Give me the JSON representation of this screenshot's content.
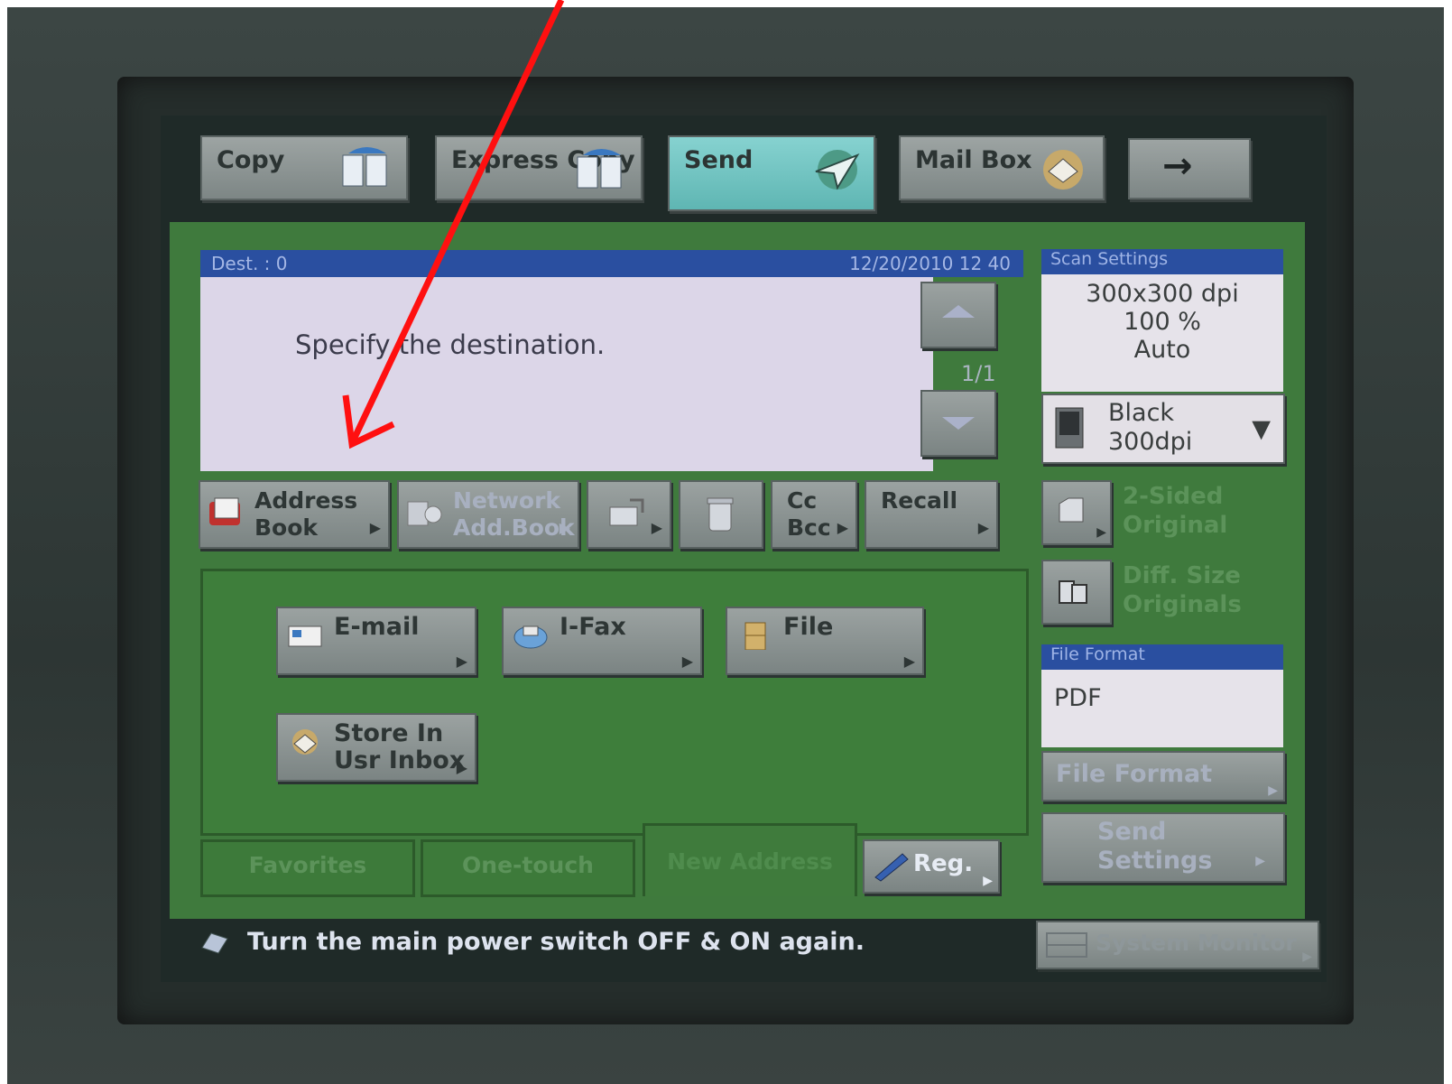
{
  "tabs": [
    {
      "label": "Copy",
      "icon": "copy-icon"
    },
    {
      "label": "Express Copy",
      "icon": "express-copy-icon"
    },
    {
      "label": "Send",
      "icon": "send-paper-plane-icon",
      "active": true
    },
    {
      "label": "Mail Box",
      "icon": "mailbox-icon"
    },
    {
      "label": "→",
      "icon": "right-arrow-icon"
    }
  ],
  "destination": {
    "header_left": "Dest. :   0",
    "header_right": "12/20/2010  12 40",
    "message": "Specify the destination.",
    "page_indicator": "1/1"
  },
  "toolbar": {
    "address_book": "Address Book",
    "network_add_book": "Network Add.Book",
    "cc_bcc_line1": "Cc",
    "cc_bcc_line2": "Bcc",
    "recall": "Recall"
  },
  "destinations": {
    "email": "E-mail",
    "ifax": "I-Fax",
    "file": "File",
    "store_line1": "Store In",
    "store_line2": "Usr Inbox"
  },
  "bottom_tabs": {
    "favorites": "Favorites",
    "one_touch": "One-touch",
    "new_address": "New Address",
    "reg": "Reg."
  },
  "scan_settings": {
    "header": "Scan Settings",
    "resolution": "300x300 dpi",
    "zoom": "100 %",
    "density": "Auto",
    "color_mode_line1": "Black",
    "color_mode_line2": "300dpi"
  },
  "side_options": {
    "two_sided_line1": "2-Sided",
    "two_sided_line2": "Original",
    "diff_size_line1": "Diff. Size",
    "diff_size_line2": "Originals"
  },
  "file_format": {
    "header": "File Format",
    "value": "PDF",
    "button": "File Format"
  },
  "send_settings": {
    "line1": "Send",
    "line2": "Settings"
  },
  "status": {
    "message": "Turn the main power switch OFF & ON again.",
    "system_monitor": "System Monitor"
  },
  "colors": {
    "panel_green": "#3f7a3d",
    "header_blue": "#2a4fa0",
    "active_tab": "#6cc3c0",
    "annotation_arrow": "#ff0000"
  }
}
